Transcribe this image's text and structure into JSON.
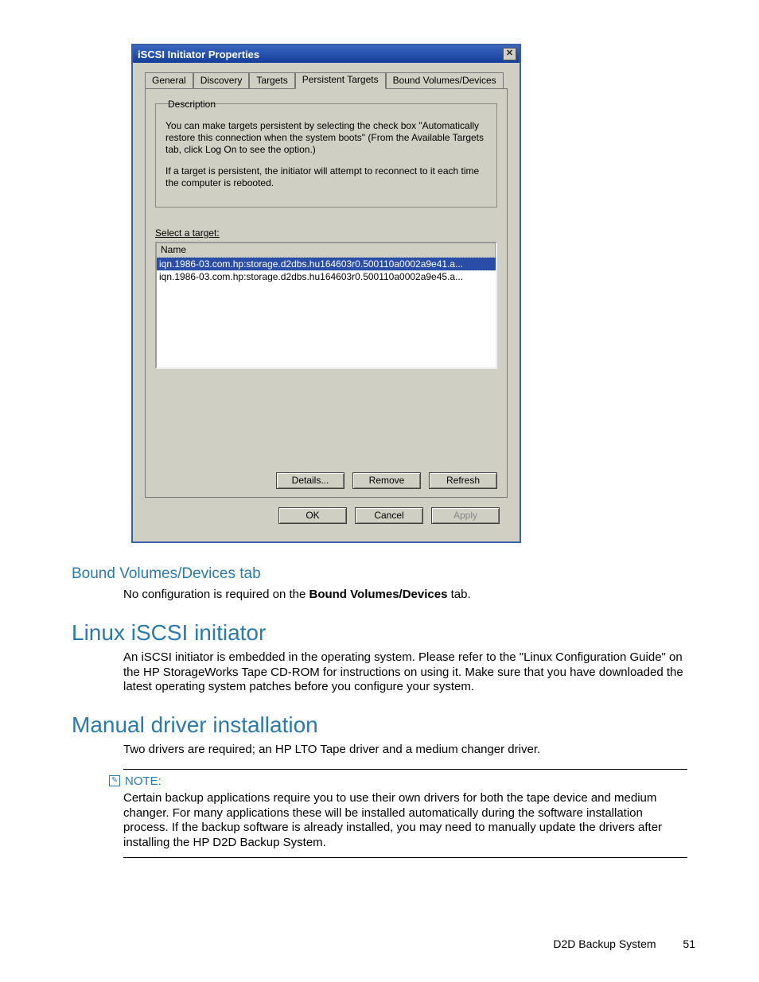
{
  "dialog": {
    "title": "iSCSI Initiator Properties",
    "close": "✕",
    "tabs": [
      "General",
      "Discovery",
      "Targets",
      "Persistent Targets",
      "Bound Volumes/Devices"
    ],
    "active_tab_index": 3,
    "description_legend": "Description",
    "description_p1": "You can make targets persistent by selecting the check box \"Automatically restore this connection when the system boots\" (From the Available Targets tab, click Log On to see the option.)",
    "description_p2": "If a target is persistent, the initiator will attempt to reconnect to it each time the computer is rebooted.",
    "select_label": "Select a target:",
    "list_header": "Name",
    "list_rows": [
      "iqn.1986-03.com.hp:storage.d2dbs.hu164603r0.500110a0002a9e41.a...",
      "iqn.1986-03.com.hp:storage.d2dbs.hu164603r0.500110a0002a9e45.a..."
    ],
    "list_selected_index": 0,
    "buttons_row": {
      "details": "Details...",
      "remove": "Remove",
      "refresh": "Refresh"
    },
    "bottom_buttons": {
      "ok": "OK",
      "cancel": "Cancel",
      "apply": "Apply"
    }
  },
  "doc": {
    "h3_bound": "Bound Volumes/Devices tab",
    "bound_para_pre": "No configuration is required on the ",
    "bound_para_bold": "Bound Volumes/Devices",
    "bound_para_post": " tab.",
    "h2_linux": "Linux iSCSI initiator",
    "linux_para": "An iSCSI initiator is embedded in the operating system.  Please refer to the \"Linux Configuration Guide\" on the HP StorageWorks Tape CD-ROM for instructions on using it.  Make sure that you have downloaded the latest operating system patches before you configure your system.",
    "h2_manual": "Manual driver installation",
    "manual_para": "Two drivers are required; an HP LTO Tape driver and a medium changer driver.",
    "note_label": "NOTE:",
    "note_body": "Certain backup applications require you to use their own drivers for both the tape device and medium changer.  For many applications these will be installed automatically during the software installation process.  If the backup software is already installed, you may need to manually update the drivers after installing the HP D2D Backup System."
  },
  "footer": {
    "text": "D2D Backup System",
    "page": "51"
  }
}
